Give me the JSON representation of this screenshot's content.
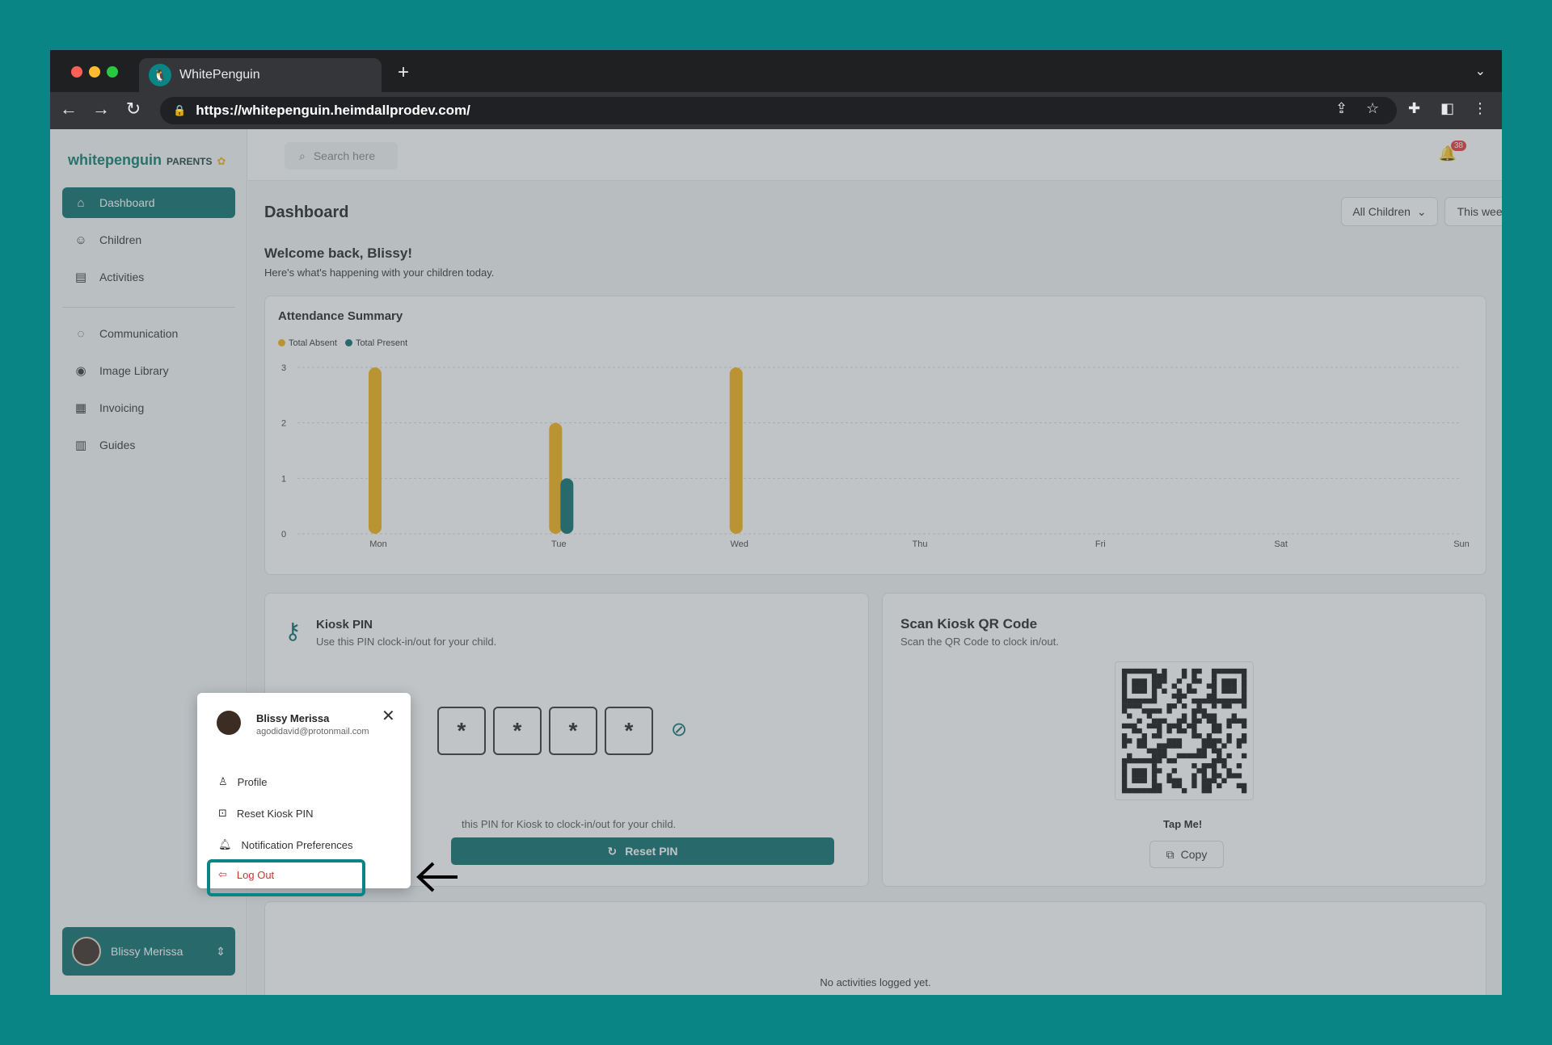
{
  "browser": {
    "tab_title": "WhitePenguin",
    "url": "https://whitepenguin.heimdallprodev.com/"
  },
  "brand": {
    "name": "whitepenguin",
    "suffix": "PARENTS"
  },
  "search": {
    "placeholder": "Search here"
  },
  "notifications": {
    "count": "38"
  },
  "sidebar": {
    "items": [
      {
        "label": "Dashboard",
        "icon": "home-icon"
      },
      {
        "label": "Children",
        "icon": "children-icon"
      },
      {
        "label": "Activities",
        "icon": "clipboard-icon"
      },
      {
        "label": "Communication",
        "icon": "chat-icon"
      },
      {
        "label": "Image Library",
        "icon": "camera-icon"
      },
      {
        "label": "Invoicing",
        "icon": "receipt-icon"
      },
      {
        "label": "Guides",
        "icon": "book-icon"
      }
    ],
    "user_name": "Blissy Merissa"
  },
  "header": {
    "title": "Dashboard",
    "filter_children": "All Children",
    "filter_period": "This week"
  },
  "welcome": {
    "title": "Welcome back, Blissy!",
    "subtitle": "Here's what's happening with your children today."
  },
  "attendance": {
    "title": "Attendance Summary"
  },
  "chart_data": {
    "type": "bar",
    "title": "Attendance Summary",
    "categories": [
      "Mon",
      "Tue",
      "Wed",
      "Thu",
      "Fri",
      "Sat",
      "Sun"
    ],
    "series": [
      {
        "name": "Total Absent",
        "color": "#f5b111",
        "values": [
          3,
          2,
          3,
          0,
          0,
          0,
          0
        ]
      },
      {
        "name": "Total Present",
        "color": "#0a6e6e",
        "values": [
          0,
          1,
          0,
          0,
          0,
          0,
          0
        ]
      }
    ],
    "ylim": [
      0,
      3
    ],
    "yticks": [
      "0",
      "1",
      "2",
      "3"
    ],
    "grid": true,
    "legend": "top-left"
  },
  "kiosk_pin": {
    "title": "Kiosk PIN",
    "subtitle": "Use this PIN clock-in/out for your child.",
    "digits": [
      "*",
      "*",
      "*",
      "*"
    ],
    "reset_note": "this PIN for Kiosk to clock-in/out for your child.",
    "reset_label": "Reset PIN"
  },
  "kiosk_qr": {
    "title": "Scan Kiosk QR Code",
    "subtitle": "Scan the QR Code to clock in/out.",
    "tap_label": "Tap Me!",
    "copy_label": "Copy"
  },
  "activities": {
    "empty_text": "No activities logged yet."
  },
  "user_menu": {
    "name": "Blissy Merissa",
    "email": "agodidavid@protonmail.com",
    "items": [
      {
        "label": "Profile",
        "icon": "user-icon"
      },
      {
        "label": "Reset Kiosk PIN",
        "icon": "pin-dots-icon"
      },
      {
        "label": "Notification Preferences",
        "icon": "bell-icon"
      },
      {
        "label": "Log Out",
        "icon": "logout-icon"
      }
    ]
  },
  "colors": {
    "brand": "#0a6e6e",
    "absent": "#f5b111",
    "present": "#0a6e6e",
    "danger": "#d32f2f"
  }
}
